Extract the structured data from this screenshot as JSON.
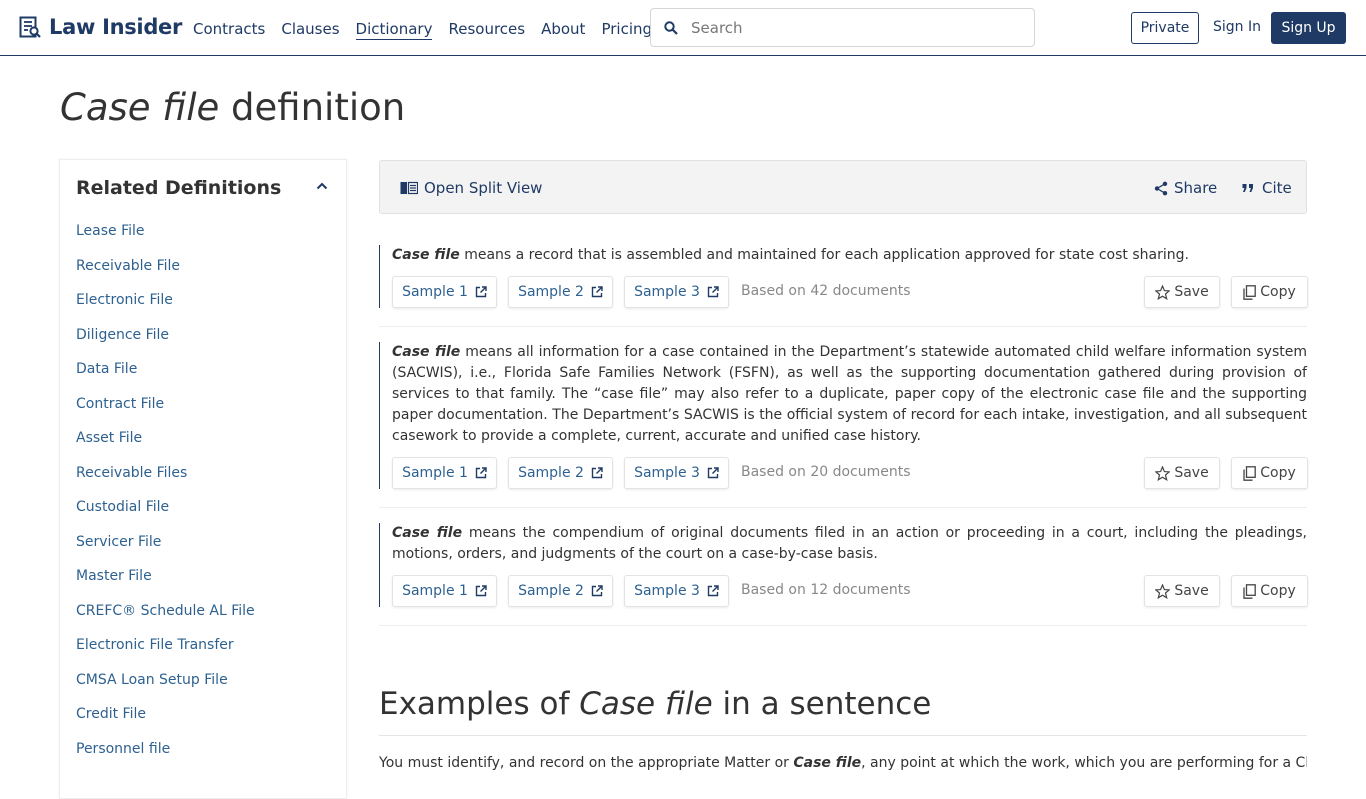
{
  "brand": {
    "name": "Law Insider"
  },
  "nav": {
    "items": [
      {
        "label": "Contracts"
      },
      {
        "label": "Clauses"
      },
      {
        "label": "Dictionary"
      },
      {
        "label": "Resources"
      },
      {
        "label": "About"
      },
      {
        "label": "Pricing"
      }
    ],
    "active": "Dictionary"
  },
  "search": {
    "placeholder": "Search"
  },
  "header_actions": {
    "private": "Private",
    "sign_in": "Sign In",
    "sign_up": "Sign Up"
  },
  "page": {
    "term": "Case file",
    "title_suffix": " definition"
  },
  "sidebar": {
    "heading": "Related Definitions",
    "items": [
      "Lease File",
      "Receivable File",
      "Electronic File",
      "Diligence File",
      "Data File",
      "Contract File",
      "Asset File",
      "Receivable Files",
      "Custodial File",
      "Servicer File",
      "Master File",
      "CREFC® Schedule AL File",
      "Electronic File Transfer",
      "CMSA Loan Setup File",
      "Credit File",
      "Personnel file"
    ]
  },
  "toolbar": {
    "split_view": "Open Split View",
    "share": "Share",
    "cite": "Cite"
  },
  "definitions": [
    {
      "term": "Case file",
      "text": " means a record that is assembled and maintained for each application approved for state cost sharing.",
      "samples": [
        "Sample 1",
        "Sample 2",
        "Sample 3"
      ],
      "based_on": "Based on 42 documents"
    },
    {
      "term": "Case file",
      "text": " means all information for a case contained in the Department’s statewide automated child welfare information system (SACWIS), i.e., Florida Safe Families Network (FSFN), as well as the supporting documentation gathered during provision of services to that family. The “case file” may also refer to a duplicate, paper copy of the electronic case file and the supporting paper documentation. The Department’s SACWIS is the official system of record for each intake, investigation, and all subsequent casework to provide a complete, current, accurate and unified case history.",
      "samples": [
        "Sample 1",
        "Sample 2",
        "Sample 3"
      ],
      "based_on": "Based on 20 documents"
    },
    {
      "term": "Case file",
      "text": " means the compendium of original documents filed in an action or proceeding in a court, including the pleadings, motions, orders, and judgments of the court on a case-by-case basis.",
      "samples": [
        "Sample 1",
        "Sample 2",
        "Sample 3"
      ],
      "based_on": "Based on 12 documents"
    }
  ],
  "actions": {
    "save": "Save",
    "copy": "Copy"
  },
  "examples": {
    "heading_prefix": "Examples of ",
    "heading_term": "Case file",
    "heading_suffix": " in a sentence",
    "first_text_before": "You must identify, and record on the appropriate Matter or ",
    "first_term": "Case file",
    "first_text_after": ", any point at which the work, which you are performing for a Client,"
  },
  "colors": {
    "brand_navy": "#1f3a64",
    "link_blue": "#2e6190"
  }
}
